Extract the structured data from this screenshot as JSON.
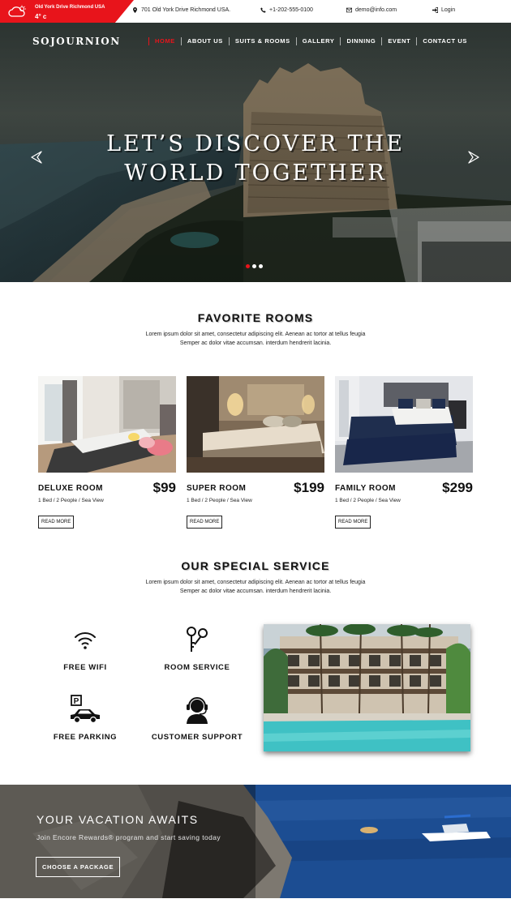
{
  "topbar": {
    "weather_location": "Old York Drive Richmond USA",
    "weather_temp": "4° c",
    "address": "701 Old York Drive Richmond USA.",
    "phone": "+1-202-555-0100",
    "email": "demo@info.com",
    "login": "Login",
    "accent": "#e8141b"
  },
  "header": {
    "logo": "SOJOURNION",
    "nav": [
      "HOME",
      "ABOUT US",
      "SUITS & ROOMS",
      "GALLERY",
      "DINNING",
      "EVENT",
      "CONTACT US"
    ]
  },
  "hero": {
    "title_line1": "LET’S DISCOVER THE",
    "title_line2": "WORLD TOGETHER",
    "slides": 3,
    "active_slide": 1
  },
  "rooms_section": {
    "title": "FAVORITE ROOMS",
    "subtitle_line1": "Lorem ipsum dolor sit amet, consectetur adipiscing elit. Aenean ac tortor at tellus feugia",
    "subtitle_line2": "Semper ac dolor vitae accumsan. interdum hendrerit lacinia.",
    "rooms": [
      {
        "name": "DELUXE ROOM",
        "price": "$99",
        "details": "1 Bed / 2 People / Sea View",
        "button": "READ MORE"
      },
      {
        "name": "SUPER ROOM",
        "price": "$199",
        "details": "1 Bed / 2 People / Sea View",
        "button": "READ MORE"
      },
      {
        "name": "FAMILY ROOM",
        "price": "$299",
        "details": "1 Bed / 2 People / Sea View",
        "button": "READ MORE"
      }
    ]
  },
  "services_section": {
    "title": "OUR SPECIAL SERVICE",
    "subtitle_line1": "Lorem ipsum dolor sit amet, consectetur adipiscing elit. Aenean ac tortor at tellus feugia",
    "subtitle_line2": "Semper ac dolor vitae accumsan. interdum hendrerit lacinia.",
    "services": [
      {
        "label": "FREE WIFI",
        "icon": "wifi-icon"
      },
      {
        "label": "ROOM SERVICE",
        "icon": "keys-icon"
      },
      {
        "label": "FREE PARKING",
        "icon": "parking-car-icon"
      },
      {
        "label": "CUSTOMER SUPPORT",
        "icon": "support-agent-icon"
      }
    ]
  },
  "banner": {
    "title": "YOUR VACATION AWAITS",
    "subtitle": "Join Encore Rewards® program and start saving today",
    "button": "CHOOSE A PACKAGE"
  }
}
